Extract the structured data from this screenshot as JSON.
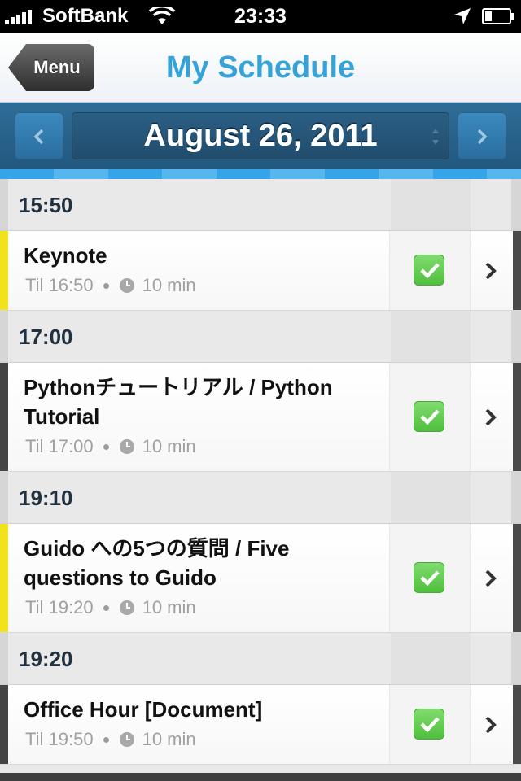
{
  "status_bar": {
    "carrier": "SoftBank",
    "time": "23:33",
    "icons": [
      "signal-icon",
      "wifi-icon",
      "location-arrow-icon",
      "battery-icon"
    ]
  },
  "nav": {
    "back_label": "Menu",
    "title": "My Schedule"
  },
  "date_bar": {
    "date": "August 26, 2011",
    "prev_icon": "chevron-left-icon",
    "next_icon": "chevron-right-icon"
  },
  "colors": {
    "title_blue": "#35a3d8",
    "date_bar": "#2a6590",
    "stripe_yellow": "#f0e31c",
    "stripe_dark": "#444444",
    "checkbox_green": "#5ccb4a"
  },
  "sections": [
    {
      "time": "15:50",
      "sessions": [
        {
          "title": "Keynote",
          "until": "Til 16:50",
          "duration": "10 min",
          "checked": true,
          "track_color": "#f0e31c"
        }
      ]
    },
    {
      "time": "17:00",
      "sessions": [
        {
          "title": "Pythonチュートリアル / Python Tutorial",
          "until": "Til 17:00",
          "duration": "10 min",
          "checked": true,
          "track_color": "#444444"
        }
      ]
    },
    {
      "time": "19:10",
      "sessions": [
        {
          "title": "Guido への5つの質問 / Five questions to Guido",
          "until": "Til 19:20",
          "duration": "10 min",
          "checked": true,
          "track_color": "#f0e31c"
        }
      ]
    },
    {
      "time": "19:20",
      "sessions": [
        {
          "title": "Office Hour [Document]",
          "until": "Til 19:50",
          "duration": "10 min",
          "checked": true,
          "track_color": "#444444"
        }
      ]
    }
  ]
}
